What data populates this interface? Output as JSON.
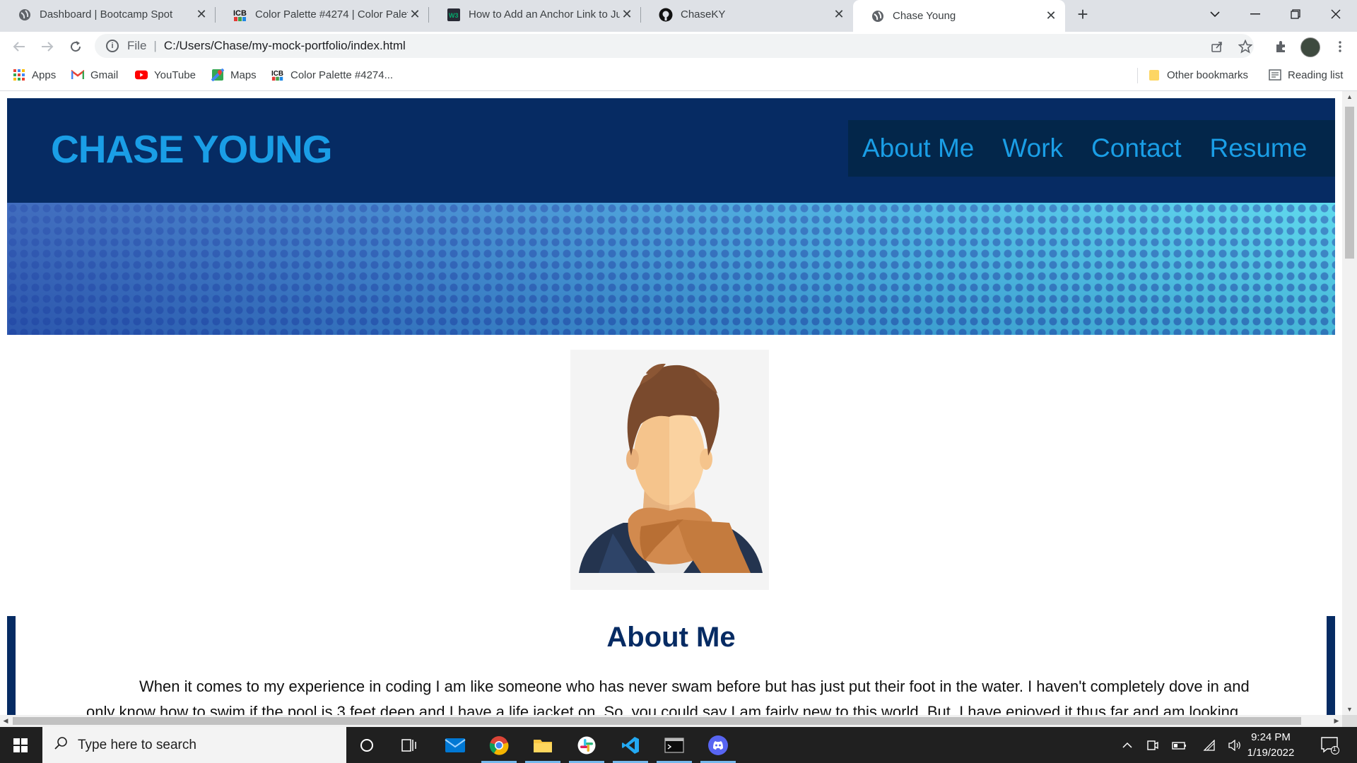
{
  "browser": {
    "tabs": [
      {
        "title": "Dashboard | Bootcamp Spot",
        "favicon": "globe-icon",
        "active": false
      },
      {
        "title": "Color Palette #4274 | Color Palett",
        "favicon": "icb-icon",
        "active": false
      },
      {
        "title": "How to Add an Anchor Link to Ju",
        "favicon": "w3-icon",
        "active": false
      },
      {
        "title": "ChaseKY",
        "favicon": "github-icon",
        "active": false
      },
      {
        "title": "Chase Young",
        "favicon": "globe-icon",
        "active": true
      }
    ],
    "new_tab_label": "+",
    "address": {
      "protocol": "File",
      "url": "C:/Users/Chase/my-mock-portfolio/index.html"
    },
    "bookmarks": [
      {
        "label": "Apps",
        "icon": "apps-grid-icon"
      },
      {
        "label": "Gmail",
        "icon": "gmail-icon"
      },
      {
        "label": "YouTube",
        "icon": "youtube-icon"
      },
      {
        "label": "Maps",
        "icon": "maps-icon"
      },
      {
        "label": "Color Palette #4274...",
        "icon": "icb-icon"
      }
    ],
    "other_bookmarks": "Other bookmarks",
    "reading_list": "Reading list"
  },
  "page": {
    "site_name": "CHASE YOUNG",
    "nav": [
      "About Me",
      "Work",
      "Contact",
      "Resume"
    ],
    "about_title": "About Me",
    "about_text": "When it comes to my experience in coding I am like someone who has never swam before but has just put their foot in the water. I haven't completely dove in and only know how to swim if the pool is 3 feet deep and I have a life jacket on. So, you could say I am fairly new to this world. But, I have enjoyed it thus far and am looking forward to",
    "colors": {
      "header_bg": "#062b63",
      "nav_bg": "#03264a",
      "accent": "#1a9ee6"
    }
  },
  "taskbar": {
    "search_placeholder": "Type here to search",
    "time": "9:24 PM",
    "date": "1/19/2022",
    "notification_count": "1"
  }
}
